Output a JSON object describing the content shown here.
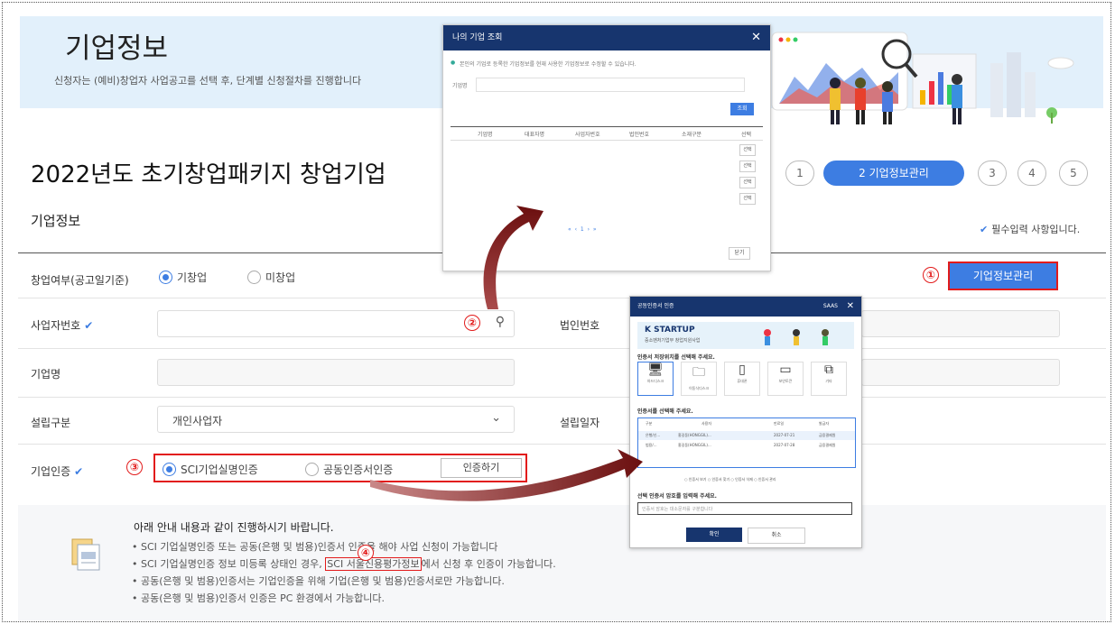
{
  "hero": {
    "title": "기업정보",
    "subtitle": "신청자는 (예비)창업자 사업공고를 선택 후, 단계별 신청절차를 진행합니다"
  },
  "page_title": "2022년도 초기창업패키지 창업기업",
  "steps": [
    {
      "label": "1",
      "active": false
    },
    {
      "label": "2  기업정보관리",
      "active": true
    },
    {
      "label": "3",
      "active": false
    },
    {
      "label": "4",
      "active": false
    },
    {
      "label": "5",
      "active": false
    }
  ],
  "section_title": "기업정보",
  "required_note": "필수입력 사항입니다.",
  "form": {
    "startup_status_label": "창업여부(공고일기준)",
    "startup_status_options": [
      "기창업",
      "미창업"
    ],
    "business_number_label": "사업자번호",
    "corp_number_label": "법인번호",
    "company_name_label": "기업명",
    "establishment_type_label": "설립구분",
    "establishment_type_value": "개인사업자",
    "establishment_date_label": "설립일자",
    "cert_label": "기업인증",
    "cert_options": [
      "SCI기업실명인증",
      "공동인증서인증"
    ],
    "cert_button": "인증하기",
    "manage_button": "기업정보관리"
  },
  "callouts": [
    "①",
    "②",
    "③",
    "④"
  ],
  "notice": {
    "title": "아래 안내 내용과 같이 진행하시기 바랍니다.",
    "lines": [
      "• SCI 기업실명인증 또는 공동(은행 및 범용)인증서 인증을 해야 사업 신청이 가능합니다",
      "• SCI 기업실명인증 정보 미등록 상태인 경우,",
      "SCI 서울신용평가정보",
      "에서 신청 후 인증이 가능합니다.",
      "• 공동(은행 및 범용)인증서는 기업인증을 위해 기업(은행 및 범용)인증서로만 가능합니다.",
      "• 공동(은행 및 범용)인증서 인증은 PC 환경에서 가능합니다."
    ]
  },
  "popup1": {
    "title": "나의 기업 조회",
    "info": "본인의 기업로 등록한 기업정보를 현재 사용한 기업정보로 수정할 수 있습니다.",
    "field_label": "기업명",
    "search_button": "조회",
    "columns": [
      "기업명",
      "대표자명",
      "사업자번호",
      "법인번호",
      "소재구분",
      "선택"
    ],
    "row_buttons": [
      "선택",
      "선택",
      "선택",
      "선택"
    ],
    "pager": "« ‹ 1 › »",
    "close_button": "닫기"
  },
  "popup2": {
    "title": "공동인증서 인증",
    "title_right": "SAAS",
    "logo": "K STARTUP",
    "logo_sub": "중소벤처기업부 창업지원사업",
    "select_location_label": "인증서 저장위치를 선택해 주세요.",
    "devices": [
      {
        "label": "하드디스크",
        "icon": "🖥"
      },
      {
        "label": "이동식디스크",
        "icon": "🗀"
      },
      {
        "label": "휴대폰",
        "icon": "▯"
      },
      {
        "label": "보안토큰",
        "icon": "▭"
      },
      {
        "label": "기타",
        "icon": "⧉"
      }
    ],
    "select_cert_label": "인증서를 선택해 주세요.",
    "table_headers": [
      "구분",
      "사용자",
      "만료일",
      "발급자"
    ],
    "rows": [
      [
        "은행/신...",
        "홍길동(HONGGIL)...",
        "2027-07-21",
        "금융결제원"
      ],
      [
        "범용/...",
        "홍길동(HONGGIL)...",
        "2027-07-28",
        "금융결제원"
      ]
    ],
    "cert_options": "○ 인증서 보기   ○ 인증서 찾기   ○ 인증서 삭제   ○ 인증서 관리",
    "password_label": "선택 인증서 암호를 입력해 주세요.",
    "password_placeholder": "인증서 암호는 대소문자를 구분합니다",
    "ok_button": "확인",
    "cancel_button": "취소"
  },
  "colors": {
    "accent": "#3d7de2",
    "callout": "#e21b1b",
    "navy": "#17356e",
    "hero_bg": "#e2f0fb"
  }
}
